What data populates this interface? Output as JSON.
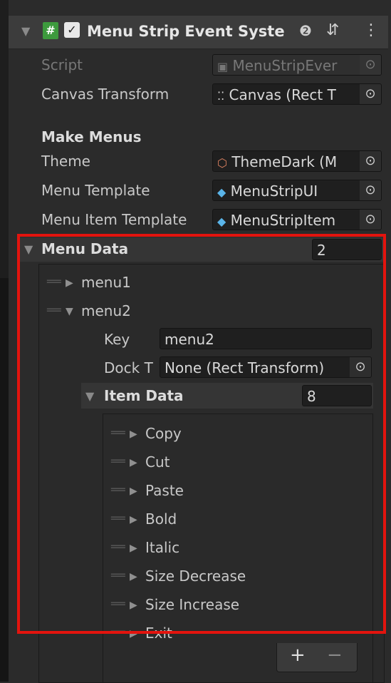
{
  "component": {
    "title": "Menu Strip Event Syste",
    "enabled": true
  },
  "fields": {
    "script_label": "Script",
    "script_value": "MenuStripEver",
    "canvas_label": "Canvas Transform",
    "canvas_value": "Canvas (Rect T",
    "section_title": "Make Menus",
    "theme_label": "Theme",
    "theme_value": "ThemeDark (M",
    "menu_template_label": "Menu Template",
    "menu_template_value": "MenuStripUI",
    "menu_item_template_label": "Menu Item Template",
    "menu_item_template_value": "MenuStripItem"
  },
  "menu_data": {
    "label": "Menu Data",
    "size": "2",
    "menus": [
      {
        "label": "menu1",
        "expanded": false
      },
      {
        "label": "menu2",
        "expanded": true
      }
    ],
    "menu2": {
      "key_label": "Key",
      "key_value": "menu2",
      "dock_label": "Dock T",
      "dock_value": "None (Rect Transform)",
      "item_data_label": "Item Data",
      "item_data_size": "8",
      "items": [
        "Copy",
        "Cut",
        "Paste",
        "Bold",
        "Italic",
        "Size Decrease",
        "Size Increase",
        "Exit"
      ]
    }
  },
  "footer": {
    "add_label": "+",
    "remove_label": "−"
  },
  "highlight_color": "#e3140e"
}
